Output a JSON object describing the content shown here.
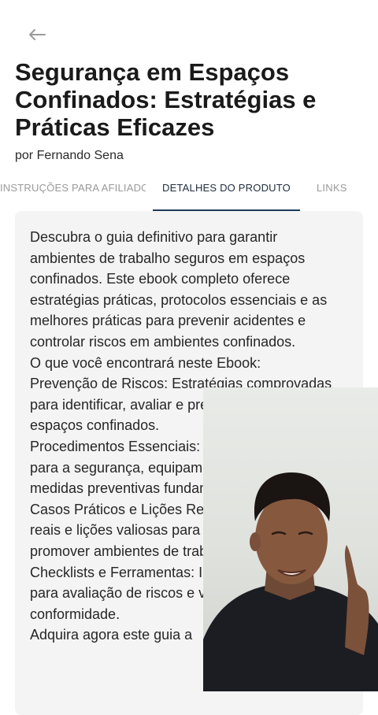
{
  "header": {
    "back_icon": "arrow-left-icon"
  },
  "product": {
    "title": "Segurança em Espaços Confinados: Estratégias e Práticas Eficazes",
    "author": "por Fernando Sena"
  },
  "tabs": [
    {
      "label": "INSTRUÇÕES PARA AFILIADOS",
      "active": false
    },
    {
      "label": "DETALHES DO PRODUTO",
      "active": true
    },
    {
      "label": "LINKS",
      "active": false
    }
  ],
  "details": {
    "description": "Descubra o guia definitivo para garantir ambientes de trabalho seguros em espaços confinados. Este ebook completo oferece estratégias práticas, protocolos essenciais e as melhores práticas para prevenir acidentes e controlar riscos em ambientes confinados.\nO que você encontrará neste Ebook:\nPrevenção de Riscos: Estratégias comprovadas para identificar, avaliar e prevenir riscos nos espaços confinados.\nProcedimentos Essenciais: Protocolos detalhados para a segurança, equipamentos necessários e medidas preventivas fundamentais.\nCasos Práticos e Lições Reais: Análise de casos reais e lições valiosas para evitar incidentes e promover ambientes de trabalho mais seguros.\nChecklists e Ferramentas: Instrumentos práticos para avaliação de riscos e verificação de conformidade.\nAdquira agora este guia a"
  },
  "colors": {
    "accent": "#1e3a5a",
    "tab_inactive": "#9a9a9a",
    "card_bg": "#f4f4f4"
  },
  "overlay": {
    "type": "video-selfie"
  }
}
